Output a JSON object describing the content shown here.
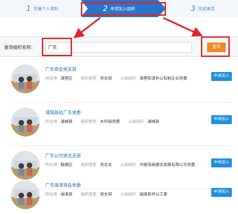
{
  "steps": [
    {
      "num": "1",
      "label": "完善个人资料"
    },
    {
      "num": "2",
      "label": "申请加入组织"
    },
    {
      "num": "3",
      "label": "完成激活"
    }
  ],
  "search": {
    "label": "查询组织名称：",
    "value": "广东",
    "button": "查询"
  },
  "field_labels": {
    "location": "所在地",
    "type": "组织类型",
    "parent": "上级组织"
  },
  "join_label": "申请加入",
  "orgs": [
    {
      "name": "广东商会党支部",
      "location": "湖里区",
      "type": "党支部",
      "parent": "湖里街道非公有制企业党委"
    },
    {
      "name": "浦城县驻广东党委",
      "location": "浦城县",
      "type": "乡科级党委",
      "parent": "浦城县"
    },
    {
      "name": "广东公司党总支部",
      "location": "鼓楼区",
      "type": "党总支",
      "parent": "中建海峡建设发展有限公司党委"
    },
    {
      "name": "广东闽清商会党委",
      "location": "闽清县",
      "type": "党支部",
      "parent": "闽清县非公工委"
    }
  ],
  "colors": {
    "accent_blue": "#1e8fe0",
    "search_orange": "#f08a24",
    "annotation_red": "#e2232a",
    "step_active": "#2a74c9"
  }
}
